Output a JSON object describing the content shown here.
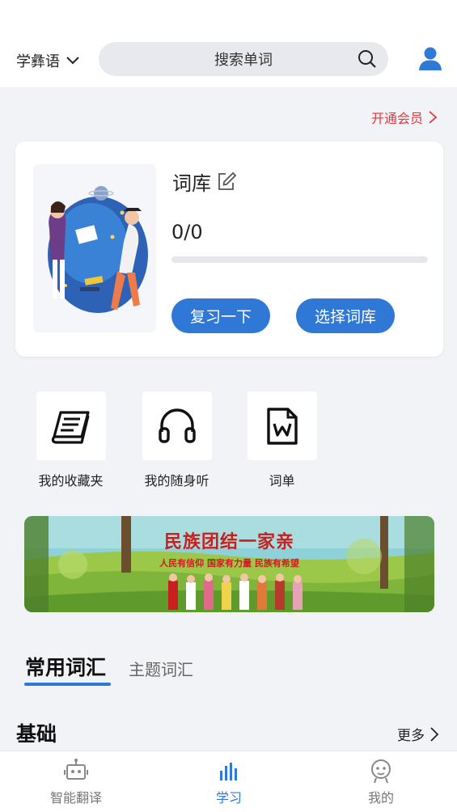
{
  "header": {
    "language": "学彝语",
    "search_placeholder": "搜索单词"
  },
  "vip": {
    "label": "开通会员"
  },
  "wordbook": {
    "title": "词库",
    "count": "0/0",
    "progress": 0,
    "review_button": "复习一下",
    "choose_button": "选择词库"
  },
  "quick_links": [
    {
      "label": "我的收藏夹",
      "icon": "notebook-icon"
    },
    {
      "label": "我的随身听",
      "icon": "headphones-icon"
    },
    {
      "label": "词单",
      "icon": "word-doc-icon"
    }
  ],
  "banner": {
    "title": "民族团结一家亲",
    "subtitle": "人民有信仰   国家有力量   民族有希望"
  },
  "tabs": {
    "active": "常用词汇",
    "inactive": "主题词汇"
  },
  "section": {
    "title": "基础",
    "more": "更多"
  },
  "tabbar": {
    "items": [
      {
        "label": "智能翻译",
        "icon": "robot-icon",
        "active": false
      },
      {
        "label": "学习",
        "icon": "bar-chart-icon",
        "active": true
      },
      {
        "label": "我的",
        "icon": "face-icon",
        "active": false
      }
    ]
  },
  "colors": {
    "accent": "#3078d6",
    "vip": "#e0383e",
    "background": "#f2f3f6"
  }
}
